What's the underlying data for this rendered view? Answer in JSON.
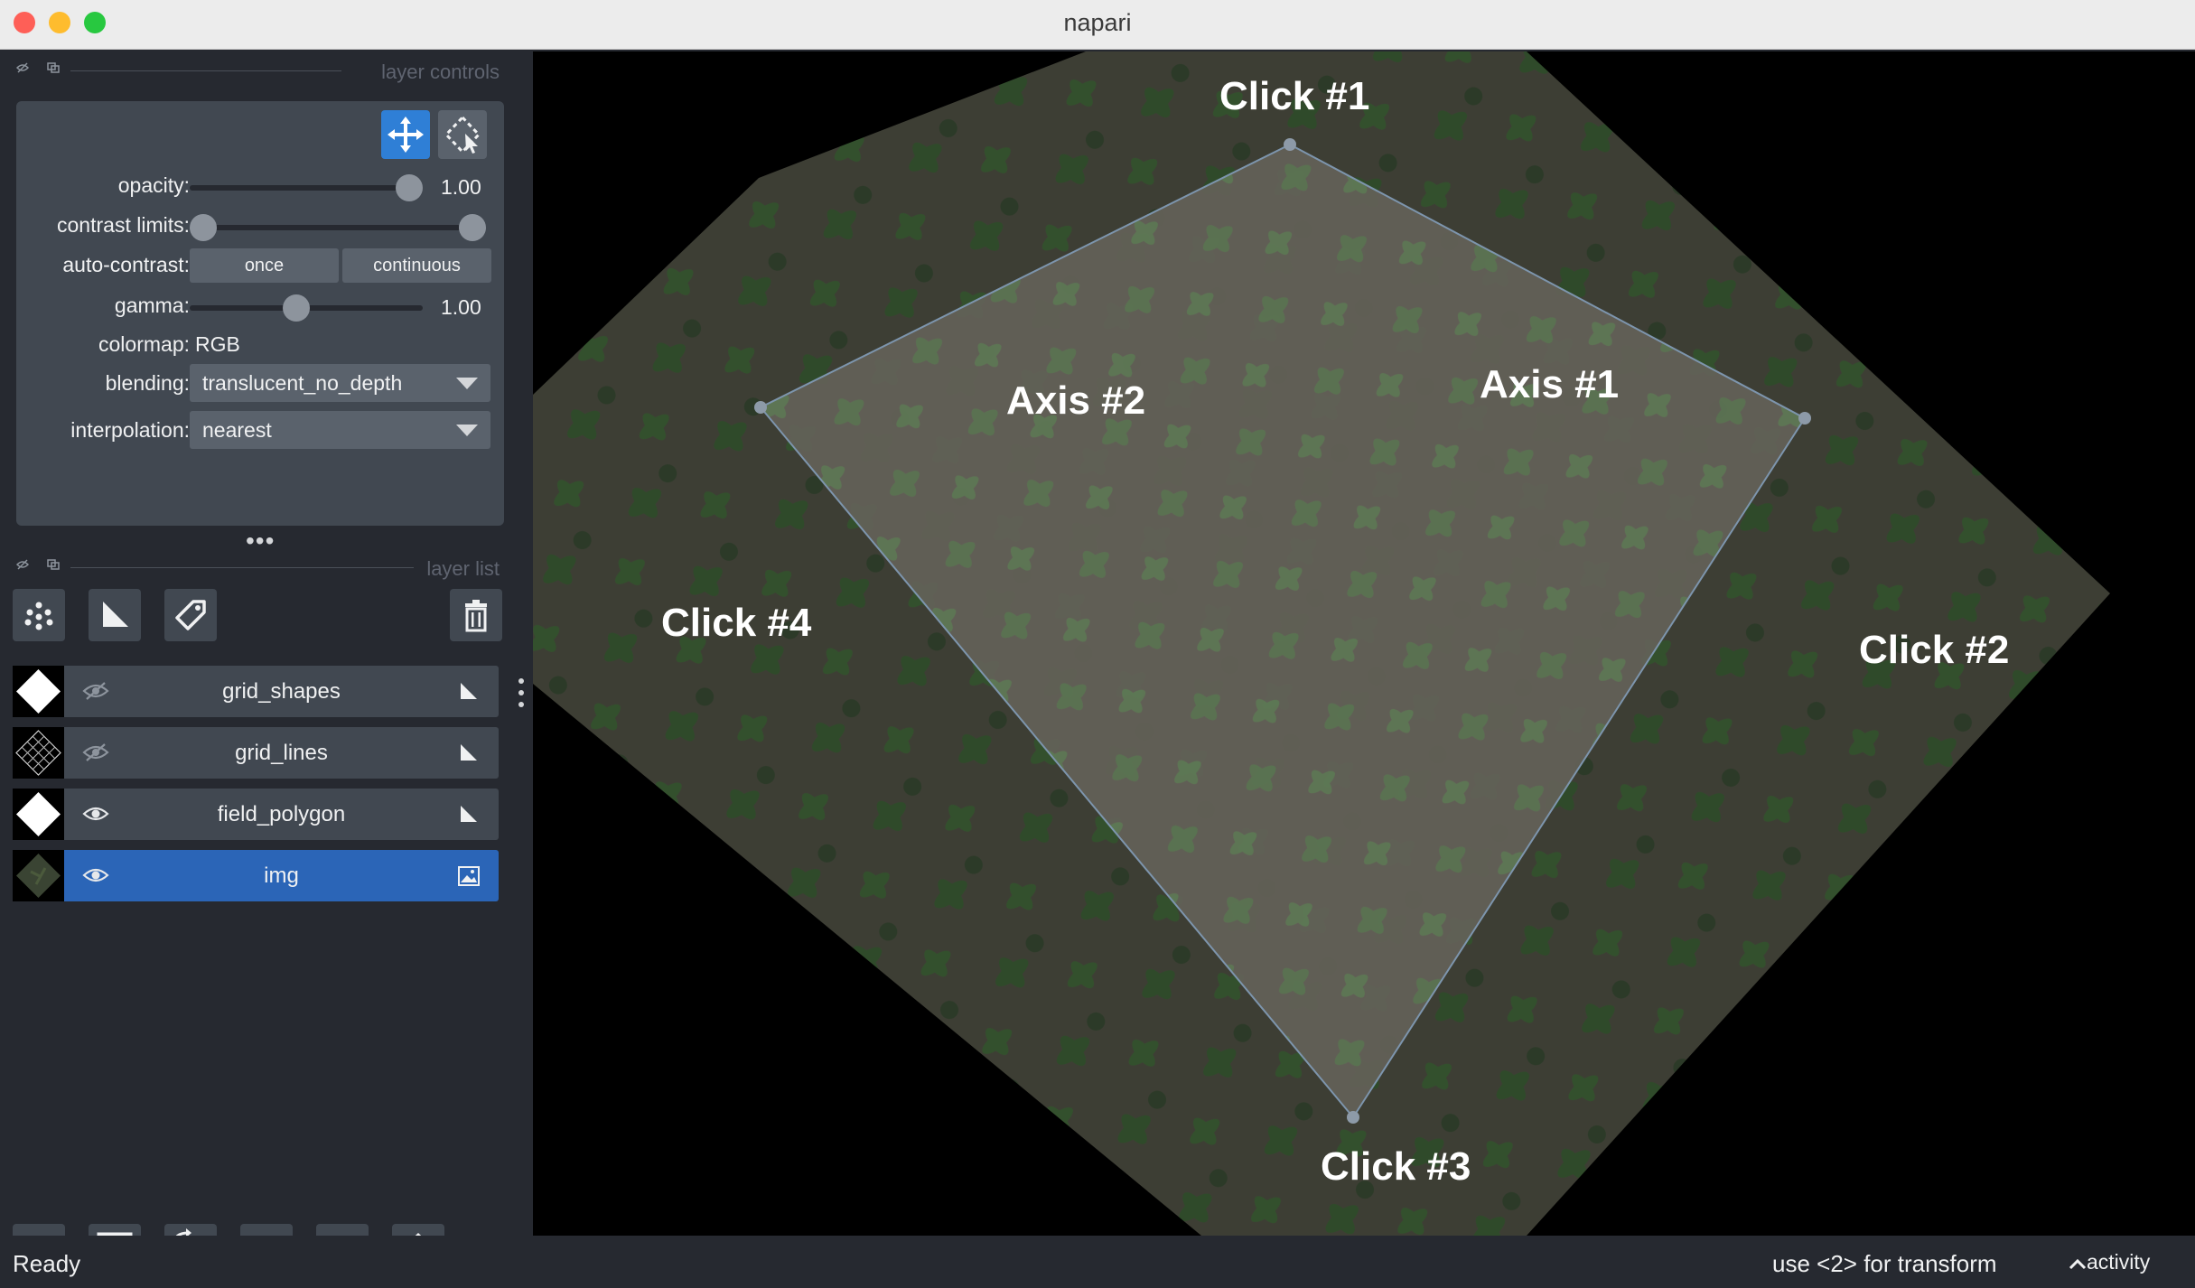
{
  "window": {
    "title": "napari"
  },
  "layer_controls": {
    "header": "layer controls",
    "opacity": {
      "label": "opacity:",
      "value": "1.00",
      "fraction": 1.0
    },
    "contrast_limits": {
      "label": "contrast limits:",
      "range": [
        0.0,
        1.0
      ]
    },
    "auto_contrast": {
      "label": "auto-contrast:",
      "once": "once",
      "continuous": "continuous"
    },
    "gamma": {
      "label": "gamma:",
      "value": "1.00",
      "fraction": 0.4
    },
    "colormap": {
      "label": "colormap:",
      "value": "RGB"
    },
    "blending": {
      "label": "blending:",
      "value": "translucent_no_depth"
    },
    "interpolation": {
      "label": "interpolation:",
      "value": "nearest"
    }
  },
  "layer_list": {
    "header": "layer list",
    "layers": [
      {
        "name": "grid_shapes",
        "visible": false,
        "type": "shapes",
        "selected": false
      },
      {
        "name": "grid_lines",
        "visible": false,
        "type": "shapes",
        "selected": false
      },
      {
        "name": "field_polygon",
        "visible": true,
        "type": "shapes",
        "selected": false
      },
      {
        "name": "img",
        "visible": true,
        "type": "image",
        "selected": true
      }
    ]
  },
  "canvas": {
    "labels": {
      "click1": "Click #1",
      "click2": "Click #2",
      "click3": "Click #3",
      "click4": "Click #4",
      "axis1": "Axis #1",
      "axis2": "Axis #2"
    }
  },
  "status": {
    "left": "Ready",
    "right": "use <2> for transform",
    "activity": "activity"
  },
  "colors": {
    "panel_bg": "#262930",
    "control_bg": "#414851",
    "selected_layer": "#2b65b7",
    "active_tool": "#2f7fd6"
  }
}
